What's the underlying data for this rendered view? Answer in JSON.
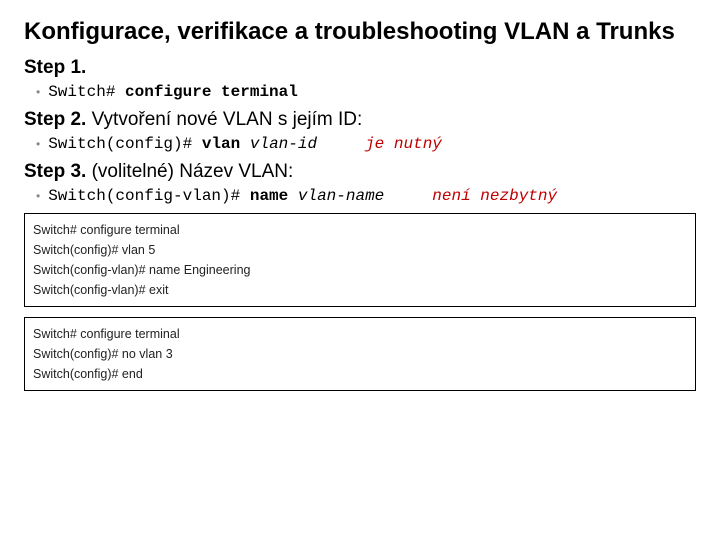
{
  "title": "Konfigurace, verifikace a troubleshooting VLAN a Trunks",
  "step1": {
    "label": "Step 1.",
    "rest": ""
  },
  "cmd1": {
    "prompt": "Switch#",
    "cmd": "configure terminal"
  },
  "step2": {
    "label": "Step 2.",
    "rest": " Vytvoření nové VLAN s jejím ID:"
  },
  "cmd2": {
    "prompt": "Switch(config)#",
    "cmd": "vlan",
    "arg": "vlan-id",
    "note": "je nutný"
  },
  "step3": {
    "label": "Step 3.",
    "rest": " (volitelné) Název VLAN:"
  },
  "cmd3": {
    "prompt": "Switch(config-vlan)#",
    "cmd": "name",
    "arg": "vlan-name",
    "note": "není nezbytný"
  },
  "box1": {
    "l1": "Switch# configure terminal",
    "l2": "Switch(config)# vlan 5",
    "l3": "Switch(config-vlan)# name Engineering",
    "l4": "Switch(config-vlan)# exit"
  },
  "box2": {
    "l1": "Switch# configure terminal",
    "l2": "Switch(config)# no vlan 3",
    "l3": "Switch(config)# end"
  }
}
